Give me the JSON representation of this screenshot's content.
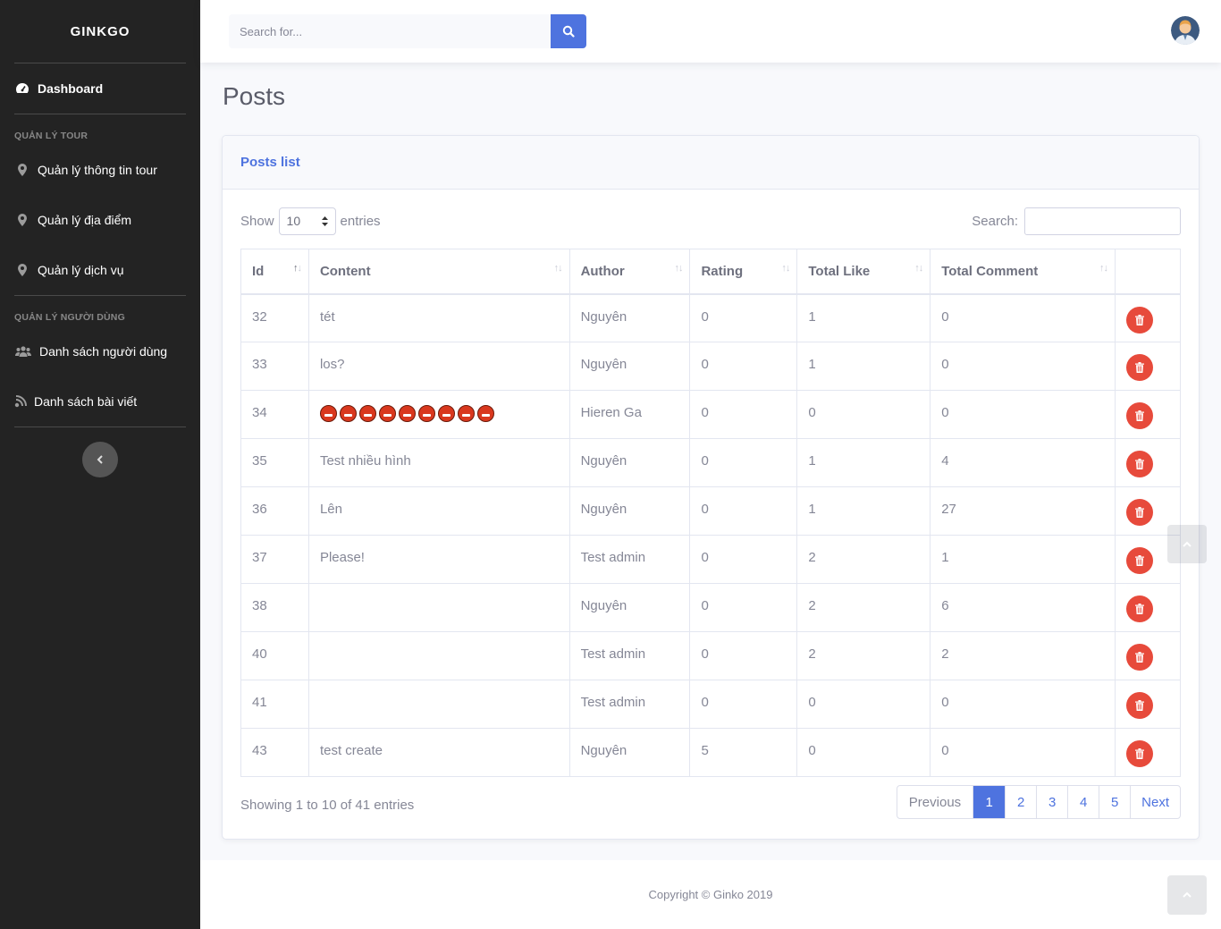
{
  "sidebar": {
    "brand": "GINKGO",
    "dashboard": {
      "label": "Dashboard",
      "icon": "tachometer-icon"
    },
    "section1": "QUẢN LÝ TOUR",
    "tour_items": [
      {
        "label": "Quản lý thông tin tour",
        "icon": "map-marker-icon"
      },
      {
        "label": "Quản lý địa điểm",
        "icon": "map-marker-icon"
      },
      {
        "label": "Quản lý dịch vụ",
        "icon": "map-marker-icon"
      }
    ],
    "section2": "QUẢN LÝ NGƯỜI DÙNG",
    "user_items": [
      {
        "label": "Danh sách người dùng",
        "icon": "users-icon"
      },
      {
        "label": "Danh sách bài viết",
        "icon": "blog-icon"
      }
    ]
  },
  "topbar": {
    "search_placeholder": "Search for...",
    "accent": "#4e73df"
  },
  "page": {
    "title": "Posts",
    "card_title": "Posts list"
  },
  "table_controls": {
    "show": "Show",
    "entries_value": "10",
    "entries": "entries",
    "search_label": "Search:"
  },
  "table": {
    "columns": [
      "Id",
      "Content",
      "Author",
      "Rating",
      "Total Like",
      "Total Comment"
    ],
    "rows": [
      {
        "id": "32",
        "content": "tét",
        "author": "Nguyên",
        "rating": "0",
        "likes": "1",
        "comments": "0"
      },
      {
        "id": "33",
        "content": "los?",
        "author": "Nguyên",
        "rating": "0",
        "likes": "1",
        "comments": "0"
      },
      {
        "id": "34",
        "content": "",
        "emoji_count": 9,
        "author": "Hieren Ga",
        "rating": "0",
        "likes": "0",
        "comments": "0"
      },
      {
        "id": "35",
        "content": "Test nhiều hình",
        "author": "Nguyên",
        "rating": "0",
        "likes": "1",
        "comments": "4"
      },
      {
        "id": "36",
        "content": "Lên",
        "author": "Nguyên",
        "rating": "0",
        "likes": "1",
        "comments": "27"
      },
      {
        "id": "37",
        "content": "Please!",
        "author": "Test admin",
        "rating": "0",
        "likes": "2",
        "comments": "1"
      },
      {
        "id": "38",
        "content": "",
        "author": "Nguyên",
        "rating": "0",
        "likes": "2",
        "comments": "6"
      },
      {
        "id": "40",
        "content": "",
        "author": "Test admin",
        "rating": "0",
        "likes": "2",
        "comments": "2"
      },
      {
        "id": "41",
        "content": "",
        "author": "Test admin",
        "rating": "0",
        "likes": "0",
        "comments": "0"
      },
      {
        "id": "43",
        "content": "test create",
        "author": "Nguyên",
        "rating": "5",
        "likes": "0",
        "comments": "0"
      }
    ],
    "delete_color": "#e74a3b"
  },
  "pagination": {
    "info": "Showing 1 to 10 of 41 entries",
    "previous": "Previous",
    "pages": [
      "1",
      "2",
      "3",
      "4",
      "5"
    ],
    "active": "1",
    "next": "Next"
  },
  "footer": {
    "copyright": "Copyright © Ginko 2019"
  }
}
